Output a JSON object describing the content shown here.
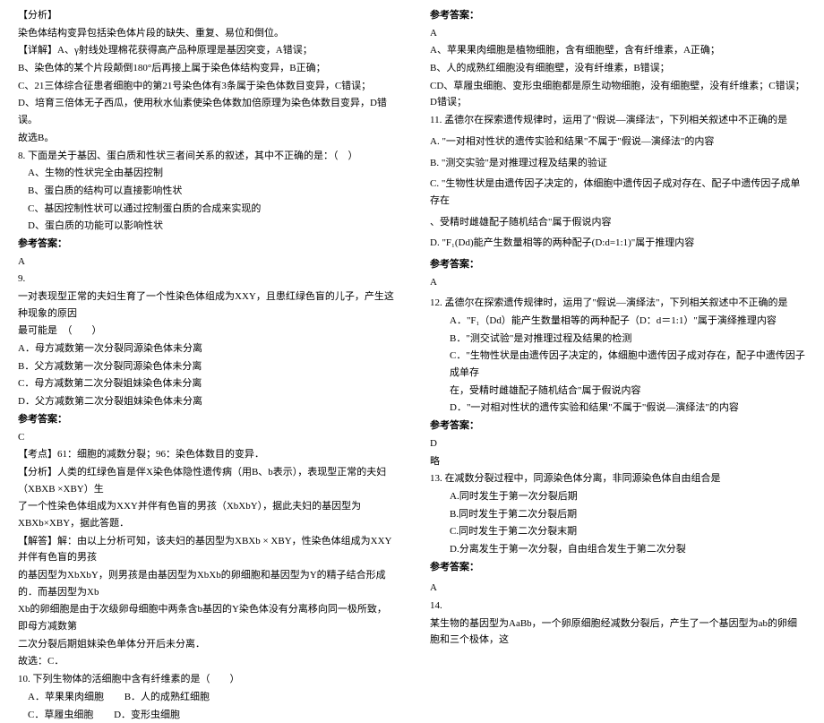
{
  "left": {
    "analysis_title": "【分析】",
    "analysis_text": "染色体结构变异包括染色体片段的缺失、重复、易位和倒位。",
    "detail_title": "【详解】A、γ射线处理棉花获得高产品种原理是基因突变，A错误；",
    "b_line": "B、染色体的某个片段颠倒180°后再接上属于染色体结构变异，B正确；",
    "c_line": "C、21三体综合征患者细胞中的第21号染色体有3条属于染色体数目变异，C错误；",
    "d_line": "D、培育三倍体无子西瓜，使用秋水仙素使染色体数加倍原理为染色体数目变异，D错误。",
    "gxb": "故选B。",
    "q8_stem": "8. 下面是关于基因、蛋白质和性状三者间关系的叙述，其中不正确的是：（　）",
    "q8_a": "A、生物的性状完全由基因控制",
    "q8_b": "B、蛋白质的结构可以直接影响性状",
    "q8_c": "C、基因控制性状可以通过控制蛋白质的合成来实现的",
    "q8_d": "D、蛋白质的功能可以影响性状",
    "ref_ans": "参考答案：",
    "q8_ans": "A",
    "q9_num": "9.",
    "q9_stem1": "一对表现型正常的夫妇生育了一个性染色体组成为XXY，且患红绿色盲的儿子，产生这种现象的原因",
    "q9_stem2": "最可能是　（　　）",
    "q9_a": "A．母方减数第一次分裂同源染色体未分离",
    "q9_b": "B．父方减数第一次分裂同源染色体未分离",
    "q9_c": "C．母方减数第二次分裂姐妹染色体未分离",
    "q9_d": "D．父方减数第二次分裂姐妹染色体未分离",
    "q9_ans": "C",
    "q9_kd_title": "【考点】61：细胞的减数分裂；96：染色体数目的变异．",
    "q9_fx_title": "【分析】人类的红绿色盲是伴X染色体隐性遗传病（用B、b表示），表现型正常的夫妇（XBXB ×XBY）生",
    "q9_fx_2": "了一个性染色体组成为XXY并伴有色盲的男孩（XbXbY），据此夫妇的基因型为XBXb×XBY，据此答题．",
    "q9_jd_title": "【解答】解：由以上分析可知，该夫妇的基因型为XBXb × XBY，性染色体组成为XXY并伴有色盲的男孩",
    "q9_jd_2": "的基因型为XbXbY，则男孩是由基因型为XbXb的卵细胞和基因型为Y的精子结合形成的．而基因型为Xb",
    "q9_jd_3": "Xb的卵细胞是由于次级卵母细胞中两条含b基因的Y染色体没有分离移向同一极所致，即母方减数第",
    "q9_jd_4": "二次分裂后期姐妹染色单体分开后未分离．",
    "q9_gx": "故选：C．",
    "q10_stem": "10. 下列生物体的活细胞中含有纤维素的是（　　）",
    "q10_a": "A．苹果果肉细胞",
    "q10_b": "B．人的成熟红细胞",
    "q10_c_1": "C．草履虫细胞",
    "q10_c_2": "D．变形虫细胞"
  },
  "right": {
    "ref_ans": "参考答案：",
    "q10_ans": "A",
    "q10_exp_a": "A、苹果果肉细胞是植物细胞，含有细胞壁，含有纤维素，A正确；",
    "q10_exp_b": "B、人的成熟红细胞没有细胞壁，没有纤维素，B错误；",
    "q10_exp_cd": "CD、草履虫细胞、变形虫细胞都是原生动物细胞，没有细胞壁，没有纤维素；C错误；D错误；",
    "q11_stem": "11. 孟德尔在探索遗传规律时，运用了\"假说—演绎法\"，下列相关叙述中不正确的是",
    "q11_a": "A. \"一对相对性状的遗传实验和结果\"不属于\"假说—演绎法\"的内容",
    "q11_b": "B. \"测交实验\"是对推理过程及结果的验证",
    "q11_c1": "C. \"生物性状是由遗传因子决定的，体细胞中遗传因子成对存在、配子中遗传因子成单存在",
    "q11_c2": "、受精时雌雄配子随机结合\"属于假说内容",
    "q11_d": "D. \"F₁(Dd)能产生数量相等的两种配子(D:d=1:1)\"属于推理内容",
    "q11_ans": "A",
    "q12_stem": "12. 孟德尔在探索遗传规律时，运用了\"假说—演绎法\"，下列相关叙述中不正确的是",
    "q12_a": "A．\"F₁（Dd）能产生数量相等的两种配子（D：d＝1:1）\"属于演绎推理内容",
    "q12_b": "B．\"测交试验\"是对推理过程及结果的检测",
    "q12_c1": "C．\"生物性状是由遗传因子决定的，体细胞中遗传因子成对存在，配子中遗传因子成单存",
    "q12_c2": "在，受精时雌雄配子随机结合\"属于假说内容",
    "q12_d": "D．\"一对相对性状的遗传实验和结果\"不属于\"假说—演绎法\"的内容",
    "q12_ans": "D",
    "q12_lue": "略",
    "q13_stem": "13. 在减数分裂过程中，同源染色体分离，非同源染色体自由组合是",
    "q13_a": "A.同时发生于第一次分裂后期",
    "q13_b": "B.同时发生于第二次分裂后期",
    "q13_c": "C.同时发生于第二次分裂末期",
    "q13_d": "D.分离发生于第一次分裂，自由组合发生于第二次分裂",
    "q13_ans": "A",
    "q14_num": "14.",
    "q14_stem": "某生物的基因型为AaBb，一个卵原细胞经减数分裂后，产生了一个基因型为ab的卵细胞和三个极体，这"
  }
}
